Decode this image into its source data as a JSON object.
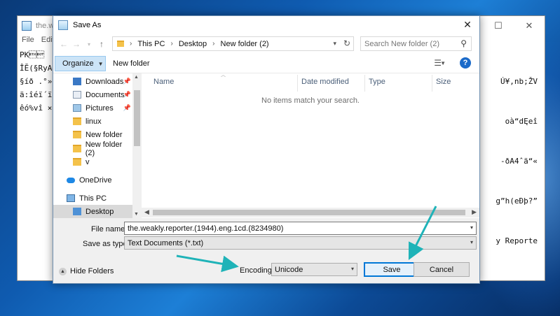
{
  "notepad": {
    "title": "the.we",
    "menu": [
      "File",
      "Edit"
    ],
    "left_lines": [
      "PK\u0003\u0004    \u0014",
      "ÎĔ(§RyA",
      "§íð .°»î",
      "ä:îéï´ïä",
      "êó%vî ×¢"
    ],
    "right_lines": [
      "Ú¥,nb;ŽV",
      "oà“dĘeî",
      "-ðA4ˆä“«",
      "g”h(eÐþ?”",
      "y Reporte"
    ]
  },
  "dialog": {
    "title": "Save As",
    "breadcrumb": [
      "This PC",
      "Desktop",
      "New folder (2)"
    ],
    "search_placeholder": "Search New folder (2)",
    "organize_label": "Organize",
    "new_folder_label": "New folder",
    "help_label": "?",
    "nav_items": [
      {
        "label": "Downloads",
        "icon": "downloads-icon",
        "pinned": true
      },
      {
        "label": "Documents",
        "icon": "documents-icon",
        "pinned": true
      },
      {
        "label": "Pictures",
        "icon": "pictures-icon",
        "pinned": true
      },
      {
        "label": "linux",
        "icon": "folder-icon",
        "pinned": false
      },
      {
        "label": "New folder",
        "icon": "folder-icon",
        "pinned": false
      },
      {
        "label": "New folder (2)",
        "icon": "folder-icon",
        "pinned": false
      },
      {
        "label": "v",
        "icon": "folder-icon",
        "pinned": false
      },
      {
        "label": "OneDrive",
        "icon": "onedrive-icon",
        "pinned": false
      },
      {
        "label": "This PC",
        "icon": "this-pc-icon",
        "pinned": false
      },
      {
        "label": "Desktop",
        "icon": "desktop-icon",
        "pinned": false,
        "selected": true
      }
    ],
    "columns": [
      "Name",
      "Date modified",
      "Type",
      "Size"
    ],
    "empty_message": "No items match your search.",
    "file_name_label": "File name:",
    "file_name_value": "the.weakly.reporter.(1944).eng.1cd.(8234980)",
    "save_as_type_label": "Save as type:",
    "save_as_type_value": "Text Documents (*.txt)",
    "encoding_label": "Encoding:",
    "encoding_value": "Unicode",
    "save_button": "Save",
    "cancel_button": "Cancel",
    "hide_folders_label": "Hide Folders"
  },
  "colors": {
    "accent": "#0078d7",
    "annotation_arrow": "#1fb3b8",
    "desktop": "#0f5bb0"
  }
}
